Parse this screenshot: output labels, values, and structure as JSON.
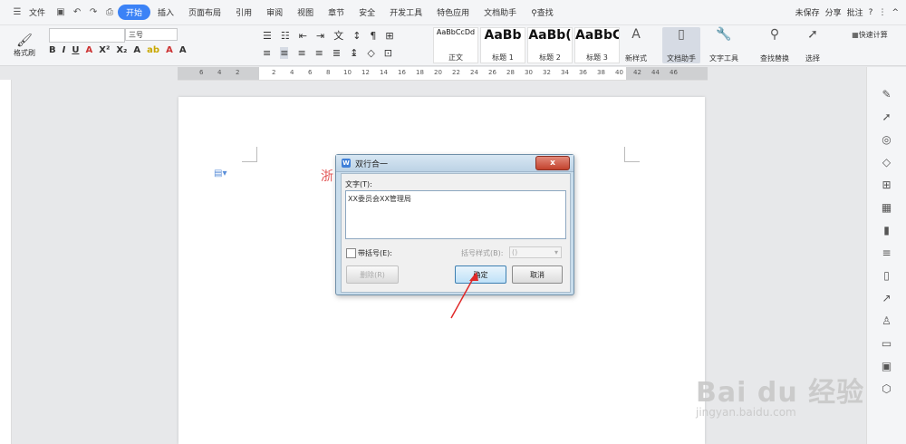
{
  "menubar": {
    "file_label": "文件",
    "tabs": [
      "开始",
      "插入",
      "页面布局",
      "引用",
      "审阅",
      "视图",
      "章节",
      "安全",
      "开发工具",
      "特色应用",
      "文档助手"
    ],
    "search_label": "查找",
    "unsaved_label": "未保存",
    "share_label": "分享",
    "comment_label": "批注",
    "help_label": "?"
  },
  "ribbon": {
    "format_painter": "格式刷",
    "font_size": "三号",
    "styles": [
      {
        "preview": "AaBbCcDd",
        "label": "正文"
      },
      {
        "preview": "AaBb",
        "label": "标题 1"
      },
      {
        "preview": "AaBb(",
        "label": "标题 2"
      },
      {
        "preview": "AaBbC",
        "label": "标题 3"
      }
    ],
    "new_style": "新样式",
    "doc_assistant": "文档助手",
    "text_tools": "文字工具",
    "find_replace": "查找替换",
    "select": "选择",
    "quick_calc": "快速计算"
  },
  "ruler": {
    "ticks": [
      "6",
      "4",
      "2",
      "",
      "2",
      "4",
      "6",
      "8",
      "10",
      "12",
      "14",
      "16",
      "18",
      "20",
      "22",
      "24",
      "26",
      "28",
      "30",
      "32",
      "34",
      "36",
      "38",
      "40",
      "42",
      "44",
      "46"
    ]
  },
  "document": {
    "visible_text": "浙"
  },
  "dialog": {
    "title": "双行合一",
    "text_label": "文字(T):",
    "text_value": "XX委员会XX管理局",
    "bracket_label": "带括号(E):",
    "bracket_style_label": "括号样式(B):",
    "bracket_style_value": "()",
    "delete_button": "删除(R)",
    "ok_button": "确定",
    "cancel_button": "取消",
    "close_glyph": "x"
  },
  "watermark": {
    "brand": "Bai du 经验",
    "url": "jingyan.baidu.com"
  }
}
